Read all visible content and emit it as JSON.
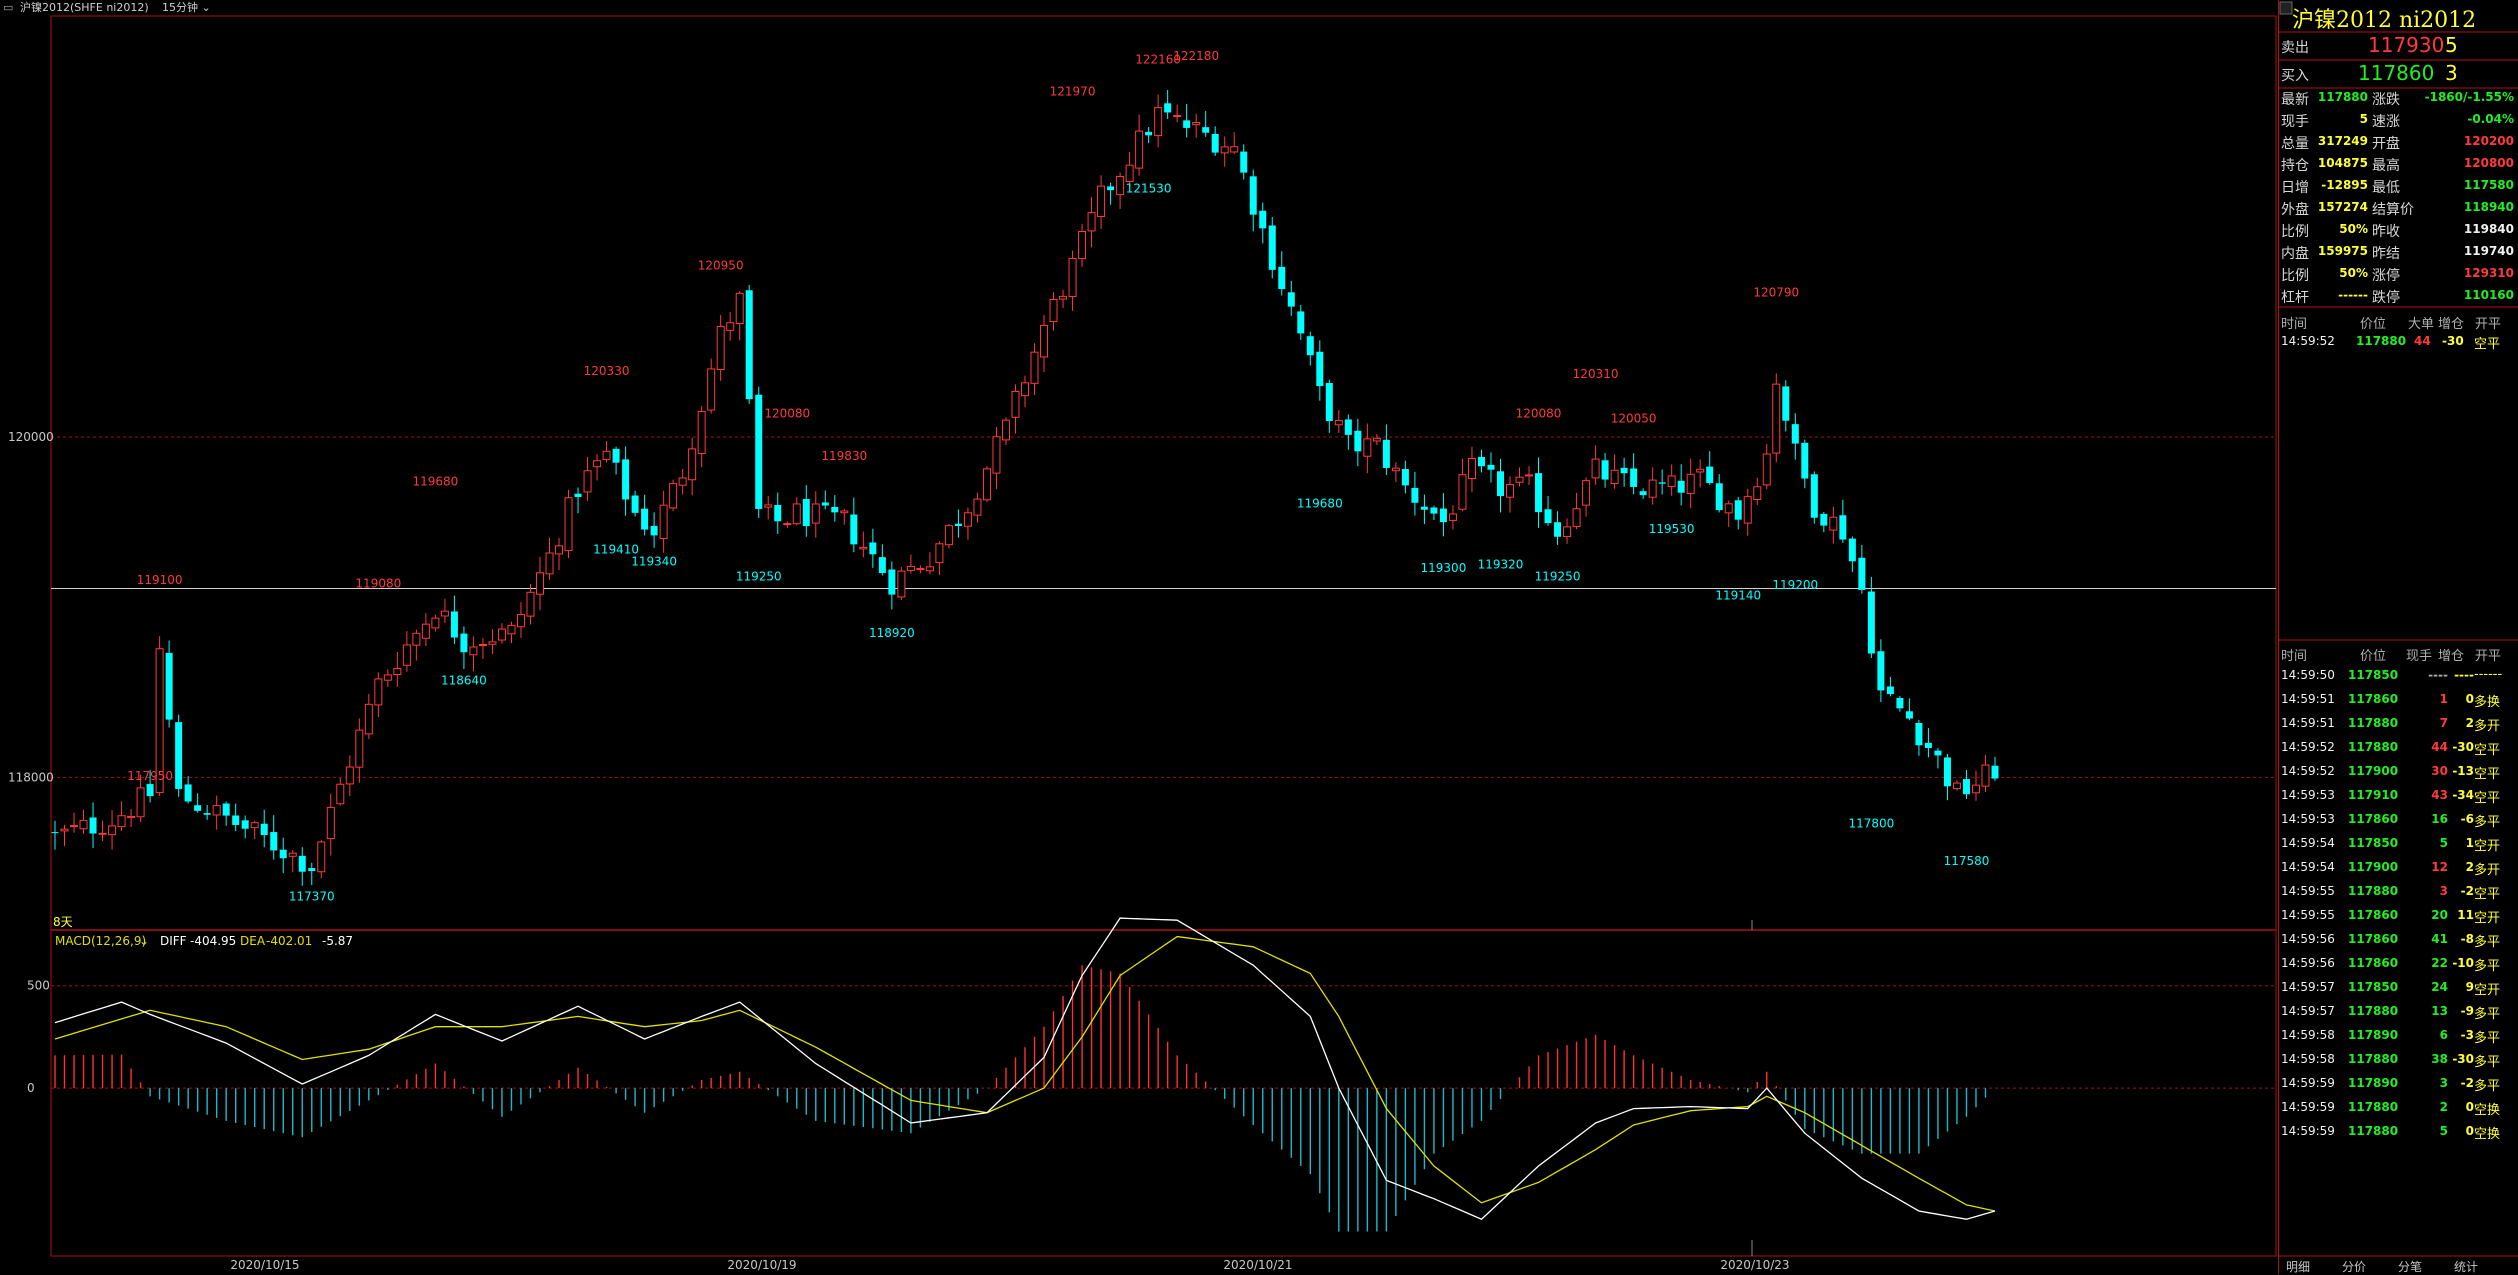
{
  "header": {
    "symbol": "沪镍2012(SHFE ni2012)",
    "period": "15分钟"
  },
  "chart_data": [
    {
      "type": "candlestick",
      "ylim": [
        117250,
        122450
      ],
      "y_ticks": [
        120000,
        118000
      ],
      "x_labels": [
        "2020/10/15",
        "2020/10/19",
        "2020/10/21",
        "2020/10/23"
      ],
      "corner_label": "8天",
      "reference_price": 119110,
      "marked_highs": [
        {
          "bar": 10,
          "value": "117950"
        },
        {
          "bar": 11,
          "value": "119100"
        },
        {
          "bar": 34,
          "value": "119080"
        },
        {
          "bar": 40,
          "value": "119680"
        },
        {
          "bar": 58,
          "value": "120330"
        },
        {
          "bar": 70,
          "value": "120950"
        },
        {
          "bar": 77,
          "value": "120080"
        },
        {
          "bar": 83,
          "value": "119830"
        },
        {
          "bar": 107,
          "value": "121970"
        },
        {
          "bar": 116,
          "value": "122160"
        },
        {
          "bar": 120,
          "value": "122180"
        },
        {
          "bar": 156,
          "value": "120080"
        },
        {
          "bar": 162,
          "value": "120310"
        },
        {
          "bar": 166,
          "value": "120050"
        },
        {
          "bar": 181,
          "value": "120790"
        }
      ],
      "marked_lows": [
        {
          "bar": 27,
          "value": "117370"
        },
        {
          "bar": 43,
          "value": "118640"
        },
        {
          "bar": 59,
          "value": "119410"
        },
        {
          "bar": 63,
          "value": "119340"
        },
        {
          "bar": 74,
          "value": "119250"
        },
        {
          "bar": 88,
          "value": "118920"
        },
        {
          "bar": 115,
          "value": "121530"
        },
        {
          "bar": 133,
          "value": "119680"
        },
        {
          "bar": 146,
          "value": "119300"
        },
        {
          "bar": 152,
          "value": "119320"
        },
        {
          "bar": 158,
          "value": "119250"
        },
        {
          "bar": 170,
          "value": "119530"
        },
        {
          "bar": 177,
          "value": "119140"
        },
        {
          "bar": 183,
          "value": "119200"
        },
        {
          "bar": 191,
          "value": "117800"
        },
        {
          "bar": 201,
          "value": "117580"
        }
      ],
      "close_path": [
        [
          0,
          117650
        ],
        [
          6,
          117750
        ],
        [
          10,
          117900
        ],
        [
          11,
          118750
        ],
        [
          13,
          117900
        ],
        [
          20,
          117700
        ],
        [
          27,
          117480
        ],
        [
          31,
          118100
        ],
        [
          34,
          118550
        ],
        [
          36,
          118700
        ],
        [
          40,
          119000
        ],
        [
          43,
          118800
        ],
        [
          48,
          118850
        ],
        [
          52,
          119300
        ],
        [
          55,
          119700
        ],
        [
          58,
          119900
        ],
        [
          61,
          119550
        ],
        [
          63,
          119450
        ],
        [
          66,
          119800
        ],
        [
          70,
          120600
        ],
        [
          72,
          120800
        ],
        [
          74,
          119550
        ],
        [
          76,
          119500
        ],
        [
          78,
          119550
        ],
        [
          83,
          119500
        ],
        [
          88,
          119150
        ],
        [
          92,
          119300
        ],
        [
          96,
          119600
        ],
        [
          100,
          120050
        ],
        [
          104,
          120650
        ],
        [
          107,
          121000
        ],
        [
          110,
          121400
        ],
        [
          113,
          121650
        ],
        [
          116,
          121900
        ],
        [
          120,
          121800
        ],
        [
          124,
          121700
        ],
        [
          128,
          121050
        ],
        [
          131,
          120600
        ],
        [
          133,
          120250
        ],
        [
          136,
          119950
        ],
        [
          139,
          119950
        ],
        [
          142,
          119700
        ],
        [
          146,
          119500
        ],
        [
          149,
          119800
        ],
        [
          152,
          119700
        ],
        [
          155,
          119700
        ],
        [
          158,
          119450
        ],
        [
          162,
          119800
        ],
        [
          166,
          119700
        ],
        [
          170,
          119700
        ],
        [
          173,
          119750
        ],
        [
          177,
          119550
        ],
        [
          180,
          119900
        ],
        [
          181,
          120350
        ],
        [
          183,
          119900
        ],
        [
          185,
          119600
        ],
        [
          188,
          119450
        ],
        [
          190,
          119100
        ],
        [
          192,
          118500
        ],
        [
          195,
          118350
        ],
        [
          198,
          118100
        ],
        [
          200,
          117900
        ],
        [
          203,
          118000
        ],
        [
          204,
          118050
        ]
      ]
    },
    {
      "type": "bar",
      "indicator_name": "MACD(12,26,9)",
      "diff_label": "DIFF",
      "diff_value": "-404.95",
      "dea_label": "DEA",
      "dea_value": "-402.01",
      "macd_value": "-5.87",
      "ylim": [
        -800,
        650
      ],
      "y_ticks": [
        "500",
        "0"
      ],
      "diff_path": [
        [
          0,
          320
        ],
        [
          7,
          420
        ],
        [
          10,
          360
        ],
        [
          18,
          220
        ],
        [
          26,
          20
        ],
        [
          33,
          160
        ],
        [
          40,
          360
        ],
        [
          47,
          230
        ],
        [
          55,
          400
        ],
        [
          62,
          240
        ],
        [
          68,
          350
        ],
        [
          72,
          420
        ],
        [
          80,
          120
        ],
        [
          90,
          -170
        ],
        [
          98,
          -120
        ],
        [
          104,
          150
        ],
        [
          108,
          550
        ],
        [
          112,
          830
        ],
        [
          118,
          820
        ],
        [
          126,
          600
        ],
        [
          132,
          350
        ],
        [
          135,
          0
        ],
        [
          140,
          -450
        ],
        [
          145,
          -540
        ],
        [
          150,
          -640
        ],
        [
          156,
          -380
        ],
        [
          162,
          -170
        ],
        [
          166,
          -100
        ],
        [
          172,
          -90
        ],
        [
          178,
          -100
        ],
        [
          180,
          0
        ],
        [
          184,
          -220
        ],
        [
          190,
          -440
        ],
        [
          196,
          -600
        ],
        [
          201,
          -640
        ],
        [
          204,
          -600
        ]
      ],
      "dea_path": [
        [
          0,
          240
        ],
        [
          10,
          380
        ],
        [
          18,
          300
        ],
        [
          26,
          140
        ],
        [
          33,
          190
        ],
        [
          40,
          300
        ],
        [
          47,
          300
        ],
        [
          55,
          350
        ],
        [
          62,
          300
        ],
        [
          68,
          330
        ],
        [
          72,
          380
        ],
        [
          80,
          200
        ],
        [
          90,
          -60
        ],
        [
          98,
          -120
        ],
        [
          104,
          0
        ],
        [
          108,
          250
        ],
        [
          112,
          550
        ],
        [
          118,
          740
        ],
        [
          126,
          690
        ],
        [
          132,
          560
        ],
        [
          135,
          350
        ],
        [
          140,
          -100
        ],
        [
          145,
          -380
        ],
        [
          150,
          -560
        ],
        [
          156,
          -460
        ],
        [
          162,
          -300
        ],
        [
          166,
          -180
        ],
        [
          172,
          -110
        ],
        [
          178,
          -90
        ],
        [
          180,
          -40
        ],
        [
          184,
          -120
        ],
        [
          190,
          -280
        ],
        [
          196,
          -440
        ],
        [
          201,
          -570
        ],
        [
          204,
          -600
        ]
      ]
    }
  ],
  "panel": {
    "title": "沪镍2012 ni2012",
    "ask_label": "卖出",
    "ask_price": "117930",
    "ask_vol": "5",
    "bid_label": "买入",
    "bid_price": "117860",
    "bid_vol": "3",
    "quote_rows": [
      {
        "l1": "最新",
        "v1": "117880",
        "c1": "green",
        "l2": "涨跌",
        "v2": "-1860/-1.55%",
        "c2": "green"
      },
      {
        "l1": "现手",
        "v1": "5",
        "c1": "yellow",
        "l2": "速涨",
        "v2": "-0.04%",
        "c2": "green"
      },
      {
        "l1": "总量",
        "v1": "317249",
        "c1": "yellow",
        "l2": "开盘",
        "v2": "120200",
        "c2": "red"
      },
      {
        "l1": "持仓",
        "v1": "104875",
        "c1": "yellow",
        "l2": "最高",
        "v2": "120800",
        "c2": "red"
      },
      {
        "l1": "日增",
        "v1": "-12895",
        "c1": "yellow",
        "l2": "最低",
        "v2": "117580",
        "c2": "green"
      },
      {
        "l1": "外盘",
        "v1": "157274",
        "c1": "yellow",
        "l2": "结算价",
        "v2": "118940",
        "c2": "green"
      },
      {
        "l1": "比例",
        "v1": "50%",
        "c1": "yellow",
        "l2": "昨收",
        "v2": "119840",
        "c2": "white"
      },
      {
        "l1": "内盘",
        "v1": "159975",
        "c1": "yellow",
        "l2": "昨结",
        "v2": "119740",
        "c2": "white"
      },
      {
        "l1": "比例",
        "v1": "50%",
        "c1": "yellow",
        "l2": "涨停",
        "v2": "129310",
        "c2": "red"
      },
      {
        "l1": "杠杆",
        "v1": "------",
        "c1": "yellow",
        "l2": "跌停",
        "v2": "110160",
        "c2": "green"
      }
    ],
    "big_header": {
      "time": "时间",
      "price": "价位",
      "big": "大单",
      "chg": "增仓",
      "oc": "开平"
    },
    "big_rows": [
      {
        "time": "14:59:52",
        "price": "117880",
        "vol": "44",
        "chg": "-30",
        "oc": "空平"
      }
    ],
    "tick_header": {
      "time": "时间",
      "price": "价位",
      "vol": "现手",
      "chg": "增仓",
      "oc": "开平"
    },
    "tick_rows": [
      {
        "time": "14:59:50",
        "price": "117850",
        "vol": "----",
        "chg": "----",
        "oc": "------",
        "vc": "gray",
        "pc": "green"
      },
      {
        "time": "14:59:51",
        "price": "117860",
        "vol": "1",
        "chg": "0",
        "oc": "多换",
        "vc": "red",
        "pc": "green"
      },
      {
        "time": "14:59:51",
        "price": "117880",
        "vol": "7",
        "chg": "2",
        "oc": "多开",
        "vc": "red",
        "pc": "green"
      },
      {
        "time": "14:59:52",
        "price": "117880",
        "vol": "44",
        "chg": "-30",
        "oc": "空平",
        "vc": "red",
        "pc": "green"
      },
      {
        "time": "14:59:52",
        "price": "117900",
        "vol": "30",
        "chg": "-13",
        "oc": "空平",
        "vc": "red",
        "pc": "green"
      },
      {
        "time": "14:59:53",
        "price": "117910",
        "vol": "43",
        "chg": "-34",
        "oc": "空平",
        "vc": "red",
        "pc": "green"
      },
      {
        "time": "14:59:53",
        "price": "117860",
        "vol": "16",
        "chg": "-6",
        "oc": "多平",
        "vc": "green",
        "pc": "green"
      },
      {
        "time": "14:59:54",
        "price": "117850",
        "vol": "5",
        "chg": "1",
        "oc": "空开",
        "vc": "green",
        "pc": "green"
      },
      {
        "time": "14:59:54",
        "price": "117900",
        "vol": "12",
        "chg": "2",
        "oc": "多开",
        "vc": "red",
        "pc": "green"
      },
      {
        "time": "14:59:55",
        "price": "117880",
        "vol": "3",
        "chg": "-2",
        "oc": "空平",
        "vc": "red",
        "pc": "green"
      },
      {
        "time": "14:59:55",
        "price": "117860",
        "vol": "20",
        "chg": "11",
        "oc": "空开",
        "vc": "green",
        "pc": "green"
      },
      {
        "time": "14:59:56",
        "price": "117860",
        "vol": "41",
        "chg": "-8",
        "oc": "多平",
        "vc": "green",
        "pc": "green"
      },
      {
        "time": "14:59:56",
        "price": "117860",
        "vol": "22",
        "chg": "-10",
        "oc": "多平",
        "vc": "green",
        "pc": "green"
      },
      {
        "time": "14:59:57",
        "price": "117850",
        "vol": "24",
        "chg": "9",
        "oc": "空开",
        "vc": "green",
        "pc": "green"
      },
      {
        "time": "14:59:57",
        "price": "117880",
        "vol": "13",
        "chg": "-9",
        "oc": "多平",
        "vc": "green",
        "pc": "green"
      },
      {
        "time": "14:59:58",
        "price": "117890",
        "vol": "6",
        "chg": "-3",
        "oc": "多平",
        "vc": "green",
        "pc": "green"
      },
      {
        "time": "14:59:58",
        "price": "117880",
        "vol": "38",
        "chg": "-30",
        "oc": "多平",
        "vc": "green",
        "pc": "green"
      },
      {
        "time": "14:59:59",
        "price": "117890",
        "vol": "3",
        "chg": "-2",
        "oc": "多平",
        "vc": "green",
        "pc": "green"
      },
      {
        "time": "14:59:59",
        "price": "117880",
        "vol": "2",
        "chg": "0",
        "oc": "空换",
        "vc": "green",
        "pc": "green"
      },
      {
        "time": "14:59:59",
        "price": "117880",
        "vol": "5",
        "chg": "0",
        "oc": "空换",
        "vc": "green",
        "pc": "green"
      }
    ],
    "tabs": [
      "明细",
      "分价",
      "分笔",
      "统计"
    ]
  },
  "colors": {
    "up": "#ff3a3a",
    "down": "#00ffff",
    "diff": "#ffffff",
    "dea": "#e0e000",
    "frame": "#b01010",
    "bg": "#000000"
  }
}
